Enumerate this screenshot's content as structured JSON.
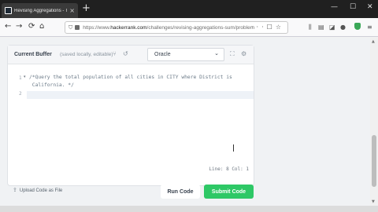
{
  "tab": {
    "title": "Revising Aggregations - The S",
    "close": "×"
  },
  "newtab": "+",
  "window": {
    "minimize": "—",
    "maximize": "☐",
    "close": "✕"
  },
  "nav": {
    "back": "←",
    "forward": "→",
    "reload": "⟳",
    "home": "⌂"
  },
  "url": {
    "prefix": "https://www.",
    "domain": "hackerrank.com",
    "path": "/challenges/revising-aggregations-sum/problem"
  },
  "editor": {
    "title": "Current Buffer",
    "subtitle": "(saved locally, editable)",
    "language": "Oracle",
    "line_numbers": [
      "1",
      "2"
    ],
    "lines": [
      "/*Query the total population of all cities in CITY where District is",
      " California. */"
    ],
    "status": "Line: 8 Col: 1"
  },
  "actions": {
    "upload": "Upload Code as File",
    "run": "Run Code",
    "submit": "Submit Code"
  },
  "colors": {
    "submit": "#2ec866",
    "tab_bg": "#202020",
    "page_bg": "#f0f2f4"
  }
}
